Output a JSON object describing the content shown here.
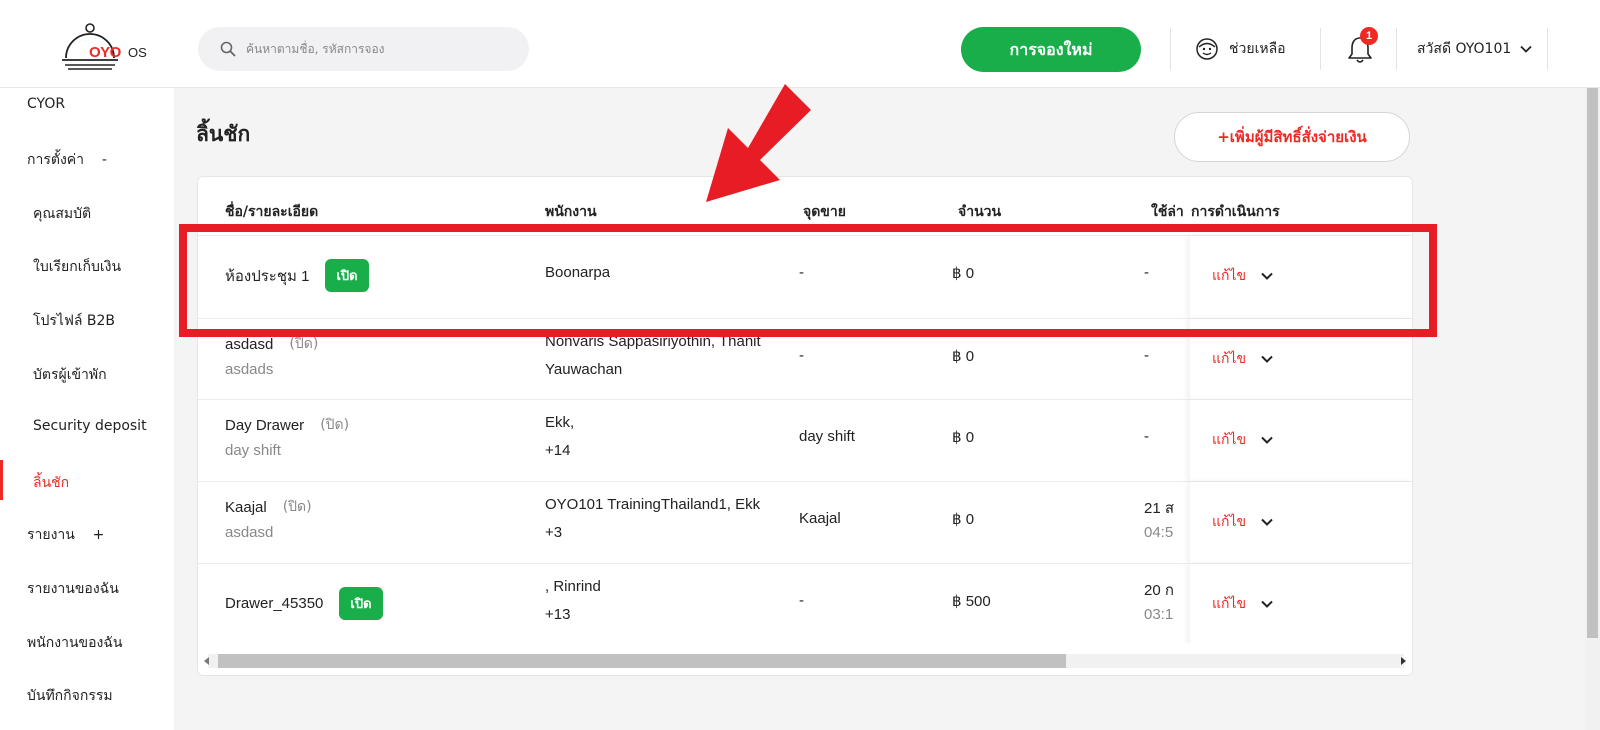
{
  "header": {
    "logo_text": "OYO",
    "logo_suffix": "OS",
    "search_placeholder": "ค้นหาตามชื่อ, รหัสการจอง",
    "new_booking_label": "การจองใหม่",
    "help_label": "ช่วยเหลือ",
    "notification_count": "1",
    "greeting": "สวัสดี OYO101"
  },
  "sidebar": {
    "items": [
      {
        "label": "CYOR"
      },
      {
        "label": "การตั้งค่า    -"
      },
      {
        "label": "คุณสมบัติ"
      },
      {
        "label": "ใบเรียกเก็บเงิน"
      },
      {
        "label": "โปรไฟล์ B2B"
      },
      {
        "label": "บัตรผู้เข้าพัก"
      },
      {
        "label": "Security deposit"
      },
      {
        "label": "ลิ้นชัก"
      },
      {
        "label": "รายงาน    +"
      },
      {
        "label": "รายงานของฉัน"
      },
      {
        "label": "พนักงานของฉัน"
      },
      {
        "label": "บันทึกกิจกรรม"
      }
    ]
  },
  "page": {
    "title": "ลิ้นชัก",
    "add_button": "+เพิ่มผู้มีสิทธิ์สั่งจ่ายเงิน"
  },
  "table": {
    "headers": [
      "ชื่อ/รายละเอียด",
      "พนักงาน",
      "จุดขาย",
      "จำนวน",
      "ใช้ล่า",
      "การดำเนินการ"
    ],
    "edit_label": "แก้ไข",
    "rows": [
      {
        "name": "ห้องประชุม 1",
        "status": "เปิด",
        "status_type": "open",
        "detail": "",
        "staff1": "Boonarpa",
        "staff2": "",
        "pos": "-",
        "amount": "฿ 0",
        "last1": "-",
        "last2": ""
      },
      {
        "name": "asdasd",
        "status": "(ปิด)",
        "status_type": "closed",
        "detail": "asdads",
        "staff1": "Nonvaris Sappasiriyothin, Thanit",
        "staff2": "Yauwachan",
        "pos": "-",
        "amount": "฿ 0",
        "last1": "-",
        "last2": ""
      },
      {
        "name": "Day Drawer",
        "status": "(ปิด)",
        "status_type": "closed",
        "detail": "day shift",
        "staff1": "Ekk,",
        "staff2": "+14",
        "pos": "day shift",
        "amount": "฿ 0",
        "last1": "-",
        "last2": ""
      },
      {
        "name": "Kaajal",
        "status": "(ปิด)",
        "status_type": "closed",
        "detail": "asdasd",
        "staff1": "OYO101 TrainingThailand1, Ekk",
        "staff2": "+3",
        "pos": "Kaajal",
        "amount": "฿ 0",
        "last1": "21 ส",
        "last2": "04:5"
      },
      {
        "name": "Drawer_45350",
        "status": "เปิด",
        "status_type": "open",
        "detail": "",
        "staff1": ", Rinrind",
        "staff2": "+13",
        "pos": "-",
        "amount": "฿ 500",
        "last1": "20 ก",
        "last2": "03:1"
      }
    ]
  },
  "colors": {
    "brand_red": "#ee2a24",
    "brand_green": "#1aae4a",
    "annotation_red": "#e81c24"
  }
}
